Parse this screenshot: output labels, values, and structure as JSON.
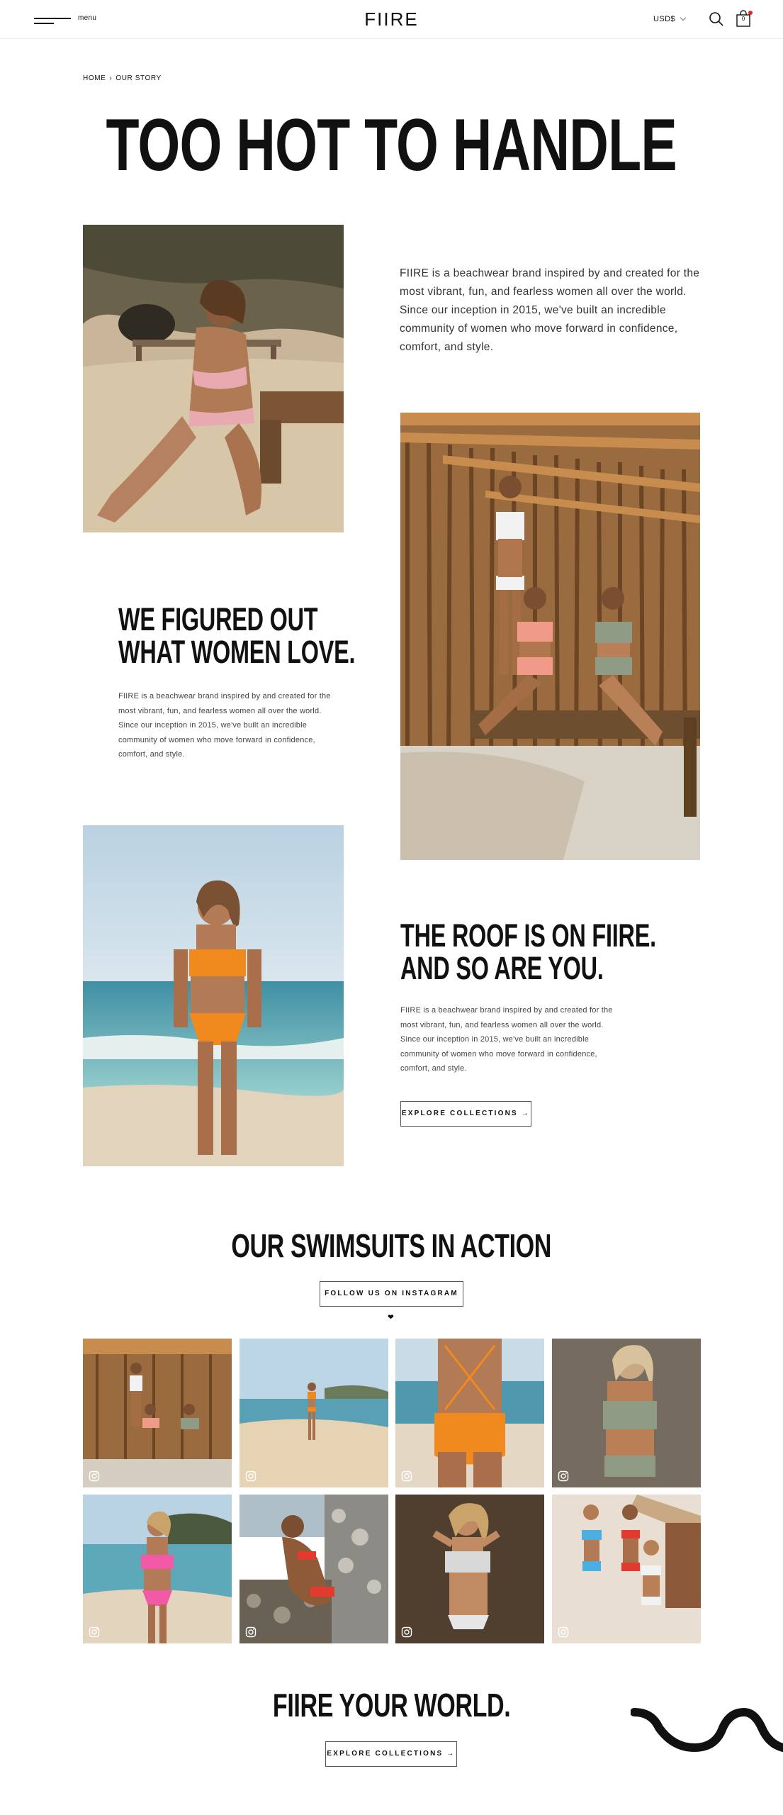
{
  "header": {
    "menu_label": "menu",
    "logo": "FIIRE",
    "currency": "USD$",
    "cart_count": "0"
  },
  "breadcrumb": {
    "home": "HOME",
    "separator": "›",
    "current": "OUR STORY"
  },
  "hero": {
    "title": "TOO HOT TO HANDLE"
  },
  "intro": {
    "text": "FIIRE is a beachwear brand inspired by and created for the most vibrant, fun, and fearless women all over the world. Since our inception in 2015, we've built an incredible community of women who move forward in confidence, comfort, and style."
  },
  "section_figured": {
    "title_line1": "WE FIGURED OUT",
    "title_line2": "WHAT WOMEN LOVE.",
    "text": "FIIRE is a beachwear brand inspired by and created for the most vibrant, fun, and fearless women all over the world. Since our inception in 2015, we've built an incredible community of women who move forward in confidence, comfort, and style."
  },
  "section_roof": {
    "title_line1": "THE ROOF IS ON FIIRE.",
    "title_line2": "AND SO ARE YOU.",
    "text": "FIIRE is a beachwear brand inspired by and created for the most vibrant, fun, and fearless women all over the world. Since our inception in 2015, we've built an incredible community of women who move forward in confidence, comfort, and style.",
    "button": "EXPLORE COLLECTIONS →"
  },
  "instagram": {
    "title": "OUR SWIMSUITS IN ACTION",
    "button": "FOLLOW US ON INSTAGRAM ❤"
  },
  "footer_cta": {
    "title": "FIIRE YOUR WORLD.",
    "button": "EXPLORE COLLECTIONS →"
  },
  "colors": {
    "text": "#111111",
    "accent_red": "#e0262b",
    "border": "#555555"
  }
}
